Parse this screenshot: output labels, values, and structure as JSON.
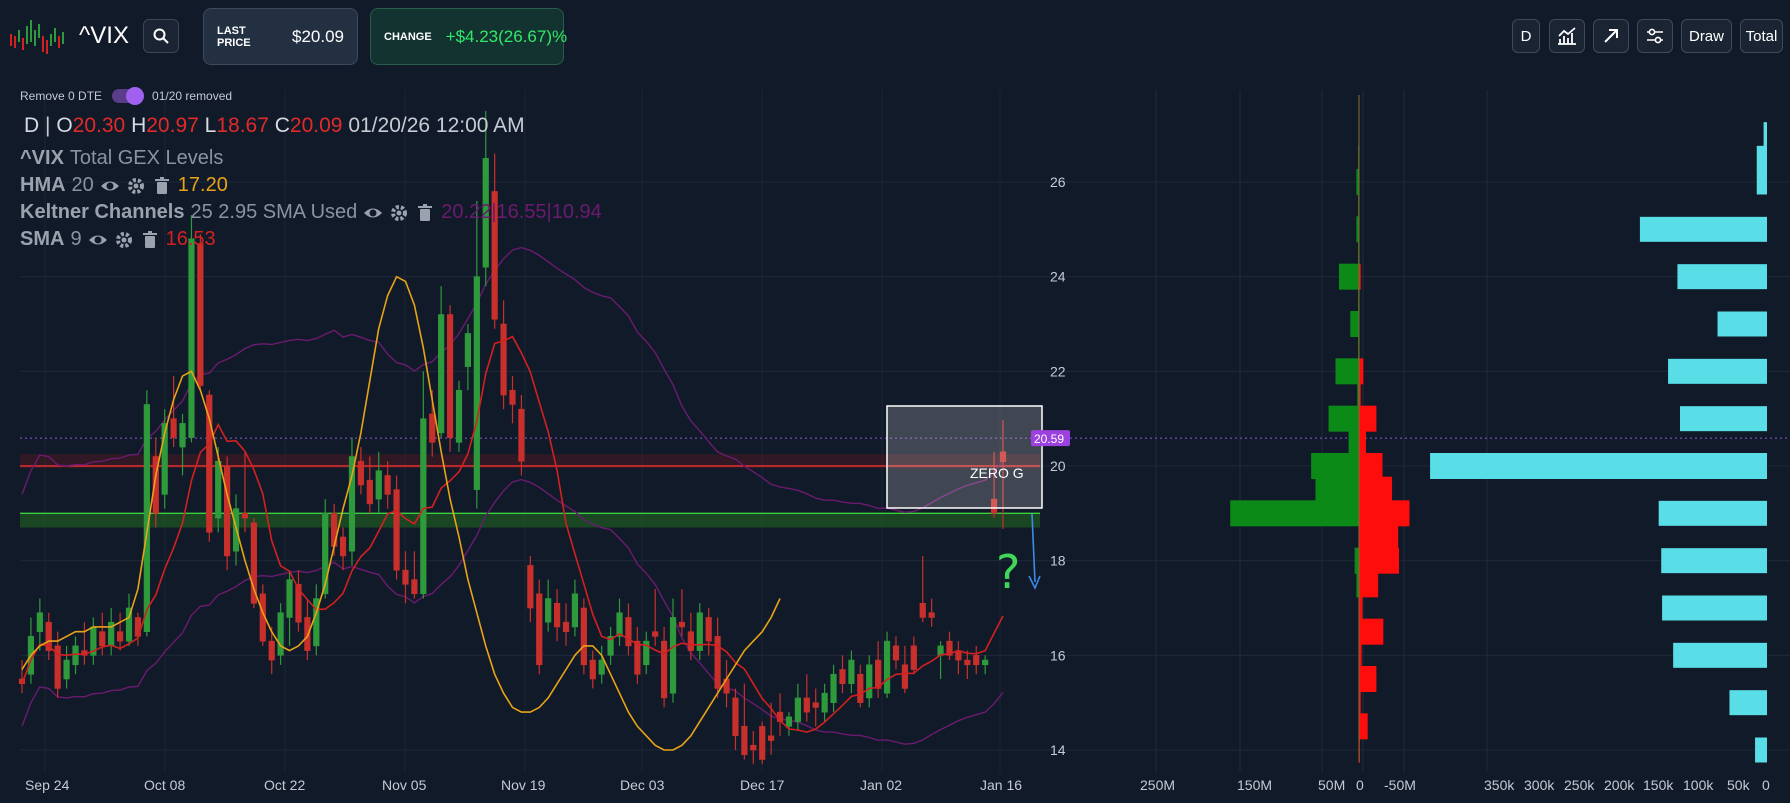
{
  "header": {
    "ticker": "^VIX",
    "last_price": {
      "label": "LAST PRICE",
      "value": "$20.09"
    },
    "change": {
      "label": "CHANGE",
      "value": "+$4.23(26.67)%"
    },
    "buttons": {
      "d": "D",
      "draw": "Draw",
      "total": "Total"
    }
  },
  "toggle": {
    "label": "Remove 0 DTE",
    "status": "01/20 removed"
  },
  "ohlc": {
    "period": "D",
    "sep": "|",
    "o_label": "O",
    "o": "20.30",
    "h_label": "H",
    "h": "20.97",
    "l_label": "L",
    "l": "18.67",
    "c_label": "C",
    "c": "20.09",
    "datetime": "01/20/26 12:00 AM"
  },
  "studies": {
    "gex": {
      "symbol": "^VIX",
      "label": "Total GEX Levels"
    },
    "hma": {
      "name": "HMA",
      "params": "20",
      "value": "17.20",
      "color": "#e8a317"
    },
    "keltner": {
      "name": "Keltner Channels",
      "params": "25 2.95 SMA Used",
      "value": "20.22|16.55|10.94",
      "color": "#6c1a70"
    },
    "sma": {
      "name": "SMA",
      "params": "9",
      "value": "16.53",
      "color": "#d42020"
    }
  },
  "colors": {
    "up": "#2e9a3c",
    "down": "#c9302c",
    "hma": "#e8a317",
    "sma": "#d42020",
    "keltner": "#6c1a70",
    "gex_pos": "#0c8a18",
    "gex_neg": "#ff0d0d",
    "oi": "#59dde6",
    "price_tag": "#9d40e0"
  },
  "annotations": {
    "zero_g": "ZERO G",
    "question": "?",
    "price_tag": "20.59"
  },
  "chart_data": [
    {
      "type": "candlestick",
      "title": "",
      "ylim": [
        13.5,
        27.5
      ],
      "x_ticks": [
        "Sep 24",
        "Oct 08",
        "Oct 22",
        "Nov 05",
        "Nov 19",
        "Dec 03",
        "Dec 17",
        "Jan 02",
        "Jan 16"
      ],
      "y_ticks": [
        14,
        16,
        18,
        20,
        22,
        24,
        26
      ],
      "levels": {
        "zero_gamma": 20.0,
        "support": 19.0,
        "last": 20.59
      },
      "candles": [
        {
          "o": 15.5,
          "h": 15.9,
          "l": 15.2,
          "c": 15.4
        },
        {
          "o": 15.6,
          "h": 16.8,
          "l": 15.4,
          "c": 16.4
        },
        {
          "o": 16.5,
          "h": 17.2,
          "l": 16.1,
          "c": 16.9
        },
        {
          "o": 16.7,
          "h": 16.9,
          "l": 15.9,
          "c": 16.1
        },
        {
          "o": 16.2,
          "h": 16.5,
          "l": 15.1,
          "c": 15.3
        },
        {
          "o": 15.5,
          "h": 16.2,
          "l": 15.3,
          "c": 15.9
        },
        {
          "o": 15.8,
          "h": 16.4,
          "l": 15.6,
          "c": 16.2
        },
        {
          "o": 16.1,
          "h": 16.7,
          "l": 15.8,
          "c": 16.0
        },
        {
          "o": 16.0,
          "h": 16.8,
          "l": 15.8,
          "c": 16.6
        },
        {
          "o": 16.5,
          "h": 16.9,
          "l": 16.0,
          "c": 16.2
        },
        {
          "o": 16.2,
          "h": 17.0,
          "l": 16.0,
          "c": 16.7
        },
        {
          "o": 16.5,
          "h": 16.9,
          "l": 16.1,
          "c": 16.3
        },
        {
          "o": 16.3,
          "h": 17.3,
          "l": 16.2,
          "c": 17.0
        },
        {
          "o": 16.8,
          "h": 16.9,
          "l": 16.2,
          "c": 16.4
        },
        {
          "o": 16.5,
          "h": 21.6,
          "l": 16.4,
          "c": 21.3
        },
        {
          "o": 20.2,
          "h": 20.6,
          "l": 18.7,
          "c": 19.0
        },
        {
          "o": 19.4,
          "h": 21.2,
          "l": 19.1,
          "c": 20.9
        },
        {
          "o": 21.0,
          "h": 21.9,
          "l": 20.4,
          "c": 20.6
        },
        {
          "o": 20.4,
          "h": 21.1,
          "l": 19.8,
          "c": 20.9
        },
        {
          "o": 20.6,
          "h": 25.3,
          "l": 20.5,
          "c": 24.8
        },
        {
          "o": 24.7,
          "h": 24.9,
          "l": 21.6,
          "c": 21.7
        },
        {
          "o": 21.5,
          "h": 21.6,
          "l": 18.4,
          "c": 18.6
        },
        {
          "o": 18.9,
          "h": 20.4,
          "l": 18.6,
          "c": 20.1
        },
        {
          "o": 20.0,
          "h": 20.2,
          "l": 17.8,
          "c": 18.1
        },
        {
          "o": 18.2,
          "h": 19.4,
          "l": 17.9,
          "c": 19.1
        },
        {
          "o": 19.0,
          "h": 20.3,
          "l": 18.6,
          "c": 18.9
        },
        {
          "o": 18.8,
          "h": 18.9,
          "l": 17.0,
          "c": 17.1
        },
        {
          "o": 17.3,
          "h": 17.5,
          "l": 16.2,
          "c": 16.3
        },
        {
          "o": 16.3,
          "h": 16.6,
          "l": 15.6,
          "c": 15.9
        },
        {
          "o": 16.0,
          "h": 17.1,
          "l": 15.8,
          "c": 16.9
        },
        {
          "o": 16.8,
          "h": 17.8,
          "l": 16.2,
          "c": 17.6
        },
        {
          "o": 17.5,
          "h": 17.8,
          "l": 16.5,
          "c": 16.7
        },
        {
          "o": 16.8,
          "h": 17.2,
          "l": 15.9,
          "c": 16.1
        },
        {
          "o": 16.2,
          "h": 17.5,
          "l": 16.0,
          "c": 17.2
        },
        {
          "o": 17.3,
          "h": 19.3,
          "l": 17.2,
          "c": 19.0
        },
        {
          "o": 19.0,
          "h": 19.2,
          "l": 18.1,
          "c": 18.3
        },
        {
          "o": 18.5,
          "h": 18.7,
          "l": 17.8,
          "c": 18.1
        },
        {
          "o": 18.2,
          "h": 20.6,
          "l": 17.9,
          "c": 20.2
        },
        {
          "o": 20.1,
          "h": 20.4,
          "l": 19.4,
          "c": 19.6
        },
        {
          "o": 19.7,
          "h": 20.2,
          "l": 19.0,
          "c": 19.2
        },
        {
          "o": 19.3,
          "h": 20.3,
          "l": 19.0,
          "c": 19.9
        },
        {
          "o": 19.8,
          "h": 20.1,
          "l": 19.1,
          "c": 19.4
        },
        {
          "o": 19.5,
          "h": 19.8,
          "l": 17.6,
          "c": 17.8
        },
        {
          "o": 17.8,
          "h": 18.2,
          "l": 17.1,
          "c": 17.5
        },
        {
          "o": 17.6,
          "h": 18.2,
          "l": 17.2,
          "c": 17.3
        },
        {
          "o": 17.3,
          "h": 22.0,
          "l": 17.2,
          "c": 21.0
        },
        {
          "o": 21.1,
          "h": 21.6,
          "l": 20.2,
          "c": 20.5
        },
        {
          "o": 20.7,
          "h": 23.8,
          "l": 20.6,
          "c": 23.2
        },
        {
          "o": 23.2,
          "h": 23.4,
          "l": 20.3,
          "c": 20.6
        },
        {
          "o": 20.5,
          "h": 21.8,
          "l": 20.3,
          "c": 21.6
        },
        {
          "o": 22.1,
          "h": 23.0,
          "l": 21.6,
          "c": 22.8
        },
        {
          "o": 19.5,
          "h": 25.6,
          "l": 19.1,
          "c": 24.0
        },
        {
          "o": 24.2,
          "h": 27.5,
          "l": 23.8,
          "c": 26.5
        },
        {
          "o": 25.8,
          "h": 26.6,
          "l": 22.9,
          "c": 23.1
        },
        {
          "o": 23.0,
          "h": 23.5,
          "l": 21.2,
          "c": 21.5
        },
        {
          "o": 21.6,
          "h": 21.9,
          "l": 20.9,
          "c": 21.3
        },
        {
          "o": 21.2,
          "h": 21.5,
          "l": 19.8,
          "c": 20.1
        },
        {
          "o": 17.9,
          "h": 18.1,
          "l": 16.7,
          "c": 17.0
        },
        {
          "o": 17.3,
          "h": 17.6,
          "l": 15.6,
          "c": 15.8
        },
        {
          "o": 16.7,
          "h": 17.6,
          "l": 16.5,
          "c": 17.2
        },
        {
          "o": 17.1,
          "h": 17.4,
          "l": 16.3,
          "c": 16.6
        },
        {
          "o": 16.7,
          "h": 17.1,
          "l": 16.2,
          "c": 16.5
        },
        {
          "o": 16.6,
          "h": 17.6,
          "l": 16.4,
          "c": 17.3
        },
        {
          "o": 17.0,
          "h": 17.2,
          "l": 15.6,
          "c": 15.8
        },
        {
          "o": 15.9,
          "h": 16.1,
          "l": 15.3,
          "c": 15.5
        },
        {
          "o": 15.6,
          "h": 16.2,
          "l": 15.4,
          "c": 15.9
        },
        {
          "o": 16.0,
          "h": 16.6,
          "l": 15.8,
          "c": 16.4
        },
        {
          "o": 16.4,
          "h": 17.2,
          "l": 16.2,
          "c": 16.9
        },
        {
          "o": 16.8,
          "h": 17.1,
          "l": 16.0,
          "c": 16.2
        },
        {
          "o": 16.3,
          "h": 16.6,
          "l": 15.4,
          "c": 15.6
        },
        {
          "o": 15.8,
          "h": 16.5,
          "l": 15.6,
          "c": 16.3
        },
        {
          "o": 16.5,
          "h": 17.4,
          "l": 16.2,
          "c": 16.4
        },
        {
          "o": 16.3,
          "h": 16.6,
          "l": 14.9,
          "c": 15.1
        },
        {
          "o": 15.2,
          "h": 17.2,
          "l": 15.0,
          "c": 16.8
        },
        {
          "o": 16.7,
          "h": 17.4,
          "l": 16.4,
          "c": 16.6
        },
        {
          "o": 16.5,
          "h": 16.9,
          "l": 15.9,
          "c": 16.1
        },
        {
          "o": 16.1,
          "h": 17.1,
          "l": 15.9,
          "c": 16.9
        },
        {
          "o": 16.8,
          "h": 17.0,
          "l": 16.0,
          "c": 16.3
        },
        {
          "o": 16.4,
          "h": 16.8,
          "l": 15.1,
          "c": 15.3
        },
        {
          "o": 15.5,
          "h": 15.9,
          "l": 14.9,
          "c": 15.2
        },
        {
          "o": 15.1,
          "h": 15.3,
          "l": 14.0,
          "c": 14.3
        },
        {
          "o": 14.5,
          "h": 15.4,
          "l": 13.8,
          "c": 13.9
        },
        {
          "o": 14.1,
          "h": 14.4,
          "l": 13.7,
          "c": 14.0
        },
        {
          "o": 14.5,
          "h": 14.6,
          "l": 13.7,
          "c": 13.8
        },
        {
          "o": 14.3,
          "h": 15.0,
          "l": 13.9,
          "c": 14.2
        },
        {
          "o": 14.8,
          "h": 15.2,
          "l": 14.3,
          "c": 14.6
        },
        {
          "o": 14.5,
          "h": 14.8,
          "l": 14.3,
          "c": 14.7
        },
        {
          "o": 14.6,
          "h": 15.4,
          "l": 14.4,
          "c": 15.1
        },
        {
          "o": 15.1,
          "h": 15.6,
          "l": 14.6,
          "c": 14.8
        },
        {
          "o": 15.0,
          "h": 15.3,
          "l": 14.5,
          "c": 14.9
        },
        {
          "o": 14.8,
          "h": 15.4,
          "l": 14.6,
          "c": 15.2
        },
        {
          "o": 15.0,
          "h": 15.8,
          "l": 14.8,
          "c": 15.6
        },
        {
          "o": 15.7,
          "h": 16.0,
          "l": 15.2,
          "c": 15.4
        },
        {
          "o": 15.4,
          "h": 16.1,
          "l": 15.2,
          "c": 15.9
        },
        {
          "o": 15.6,
          "h": 15.8,
          "l": 14.9,
          "c": 15.0
        },
        {
          "o": 15.1,
          "h": 16.0,
          "l": 14.9,
          "c": 15.8
        },
        {
          "o": 15.9,
          "h": 16.3,
          "l": 15.1,
          "c": 15.3
        },
        {
          "o": 15.2,
          "h": 16.5,
          "l": 15.1,
          "c": 16.3
        },
        {
          "o": 16.2,
          "h": 16.4,
          "l": 15.7,
          "c": 15.9
        },
        {
          "o": 15.8,
          "h": 16.2,
          "l": 15.2,
          "c": 15.3
        },
        {
          "o": 16.2,
          "h": 16.4,
          "l": 15.6,
          "c": 15.7
        },
        {
          "o": 17.1,
          "h": 18.1,
          "l": 16.7,
          "c": 16.8
        },
        {
          "o": 16.9,
          "h": 17.2,
          "l": 16.6,
          "c": 16.8
        },
        {
          "o": 16.0,
          "h": 16.3,
          "l": 15.5,
          "c": 16.2
        },
        {
          "o": 16.3,
          "h": 16.5,
          "l": 15.9,
          "c": 16.0
        },
        {
          "o": 16.1,
          "h": 16.3,
          "l": 15.6,
          "c": 15.9
        },
        {
          "o": 15.9,
          "h": 16.1,
          "l": 15.5,
          "c": 15.8
        },
        {
          "o": 16.0,
          "h": 16.2,
          "l": 15.6,
          "c": 15.8
        },
        {
          "o": 15.8,
          "h": 16.0,
          "l": 15.6,
          "c": 15.9
        },
        {
          "o": 19.3,
          "h": 20.3,
          "l": 18.9,
          "c": 19.0
        },
        {
          "o": 20.3,
          "h": 20.97,
          "l": 18.67,
          "c": 20.09
        }
      ],
      "hma_20": [
        15.7,
        16.0,
        16.2,
        16.3,
        16.3,
        16.4,
        16.5,
        16.5,
        16.6,
        16.6,
        16.6,
        16.7,
        16.8,
        17.4,
        18.6,
        19.8,
        20.7,
        21.4,
        21.9,
        22.0,
        21.6,
        21.0,
        20.2,
        19.4,
        18.7,
        18.0,
        17.4,
        16.9,
        16.5,
        16.2,
        16.1,
        16.2,
        16.4,
        16.9,
        17.5,
        18.3,
        19.1,
        19.8,
        20.7,
        21.8,
        22.9,
        23.6,
        24.0,
        23.9,
        23.4,
        22.5,
        21.4,
        20.3,
        19.3,
        18.5,
        17.6,
        16.9,
        16.2,
        15.6,
        15.2,
        14.9,
        14.8,
        14.8,
        14.9,
        15.1,
        15.4,
        15.7,
        16.0,
        16.2,
        16.2,
        16.0,
        15.6,
        15.2,
        14.8,
        14.5,
        14.3,
        14.1,
        14.0,
        14.0,
        14.1,
        14.3,
        14.6,
        14.9,
        15.2,
        15.5,
        15.8,
        16.1,
        16.3,
        16.5,
        16.8,
        17.2
      ]
    },
    {
      "type": "bar",
      "title": "",
      "orientation": "horizontal",
      "x_ticks": [
        "250M",
        "150M",
        "50M",
        "0",
        "-50M"
      ],
      "strikes": [
        27,
        26.5,
        26,
        25.5,
        25,
        24.5,
        24,
        23.5,
        23,
        22.5,
        22,
        21.5,
        21,
        20.5,
        20,
        19.5,
        19,
        18.5,
        18,
        17.5,
        17,
        16.5,
        16,
        15.5,
        15,
        14.5,
        14
      ],
      "call_gex_M": [
        0,
        1,
        3,
        1,
        3,
        1,
        23,
        1,
        10,
        1,
        27,
        2,
        35,
        12,
        55,
        50,
        148,
        0,
        5,
        3,
        0,
        0,
        0,
        0,
        0,
        0,
        0
      ],
      "put_gex_M": [
        0,
        0,
        0,
        0,
        0,
        0,
        2,
        0,
        0,
        0,
        5,
        2,
        20,
        8,
        27,
        38,
        58,
        45,
        46,
        22,
        4,
        28,
        3,
        20,
        2,
        10,
        1
      ]
    },
    {
      "type": "bar",
      "title": "",
      "orientation": "horizontal",
      "x_ticks": [
        "350k",
        "300k",
        "250k",
        "200k",
        "150k",
        "100k",
        "50k",
        "0"
      ],
      "strikes": [
        27,
        26.5,
        26,
        25,
        24,
        23,
        22,
        21,
        20,
        19,
        18,
        17,
        16,
        15,
        14
      ],
      "open_interest_k": [
        4,
        12,
        12,
        149,
        105,
        58,
        116,
        102,
        395,
        127,
        124,
        123,
        110,
        44,
        14
      ]
    }
  ]
}
